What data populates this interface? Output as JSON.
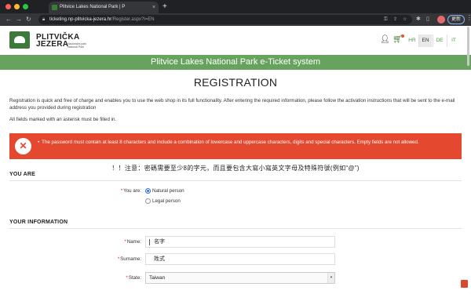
{
  "browser": {
    "tab_title": "Plitvice Lakes National Park | P",
    "tab_close": "×",
    "new_tab": "+",
    "url_host": "ticketing.np-plitvicka-jezera.hr",
    "url_path": "/Register.aspx?l=EN",
    "update_label": "更新",
    "icons": [
      "back-icon",
      "forward-icon",
      "reload-icon",
      "lock-icon",
      "key-icon",
      "share-icon",
      "bookmark-star-icon",
      "extensions-icon",
      "menu-icon"
    ]
  },
  "site": {
    "logo_line1": "PLITVIČKA",
    "logo_line2": "JEZERA",
    "logo_sub": "Nacionalni park National Park",
    "languages": [
      "HR",
      "EN",
      "DE",
      "IT"
    ],
    "active_language": "EN",
    "banner": "Plitvice Lakes National Park e-Ticket system"
  },
  "page": {
    "title": "REGISTRATION",
    "intro": "Registration is quick and free of charge and enables you to use the web shop in its full functionality. After entering the required information, please follow the activation instructions that will be sent to the e-mail address you provided during registration",
    "asterisk_note": "All fields marked with an asterisk must be filled in.",
    "error_message": "The password must contain at least 8 characters and include a combination of lowercase and uppercase characters, digits and special characters. Empty fields are not allowed.",
    "cn_note": "！！注意：密碼需要至少8的字元，而且要包含大寫小寫英文字母及特殊符號(例如“@”)"
  },
  "you_are": {
    "section_title": "YOU ARE",
    "label": "You are:",
    "options": [
      "Natural person",
      "Legal person"
    ],
    "selected": "Natural person"
  },
  "your_info": {
    "section_title": "YOUR INFORMATION",
    "name_label": "Name:",
    "name_value": "名字",
    "surname_label": "Surname:",
    "surname_value": "姓式",
    "state_label": "State:",
    "state_value": "Taiwan"
  },
  "colors": {
    "brand_green": "#67a35f",
    "error_red": "#e4492f",
    "required_red": "#d9282a"
  }
}
